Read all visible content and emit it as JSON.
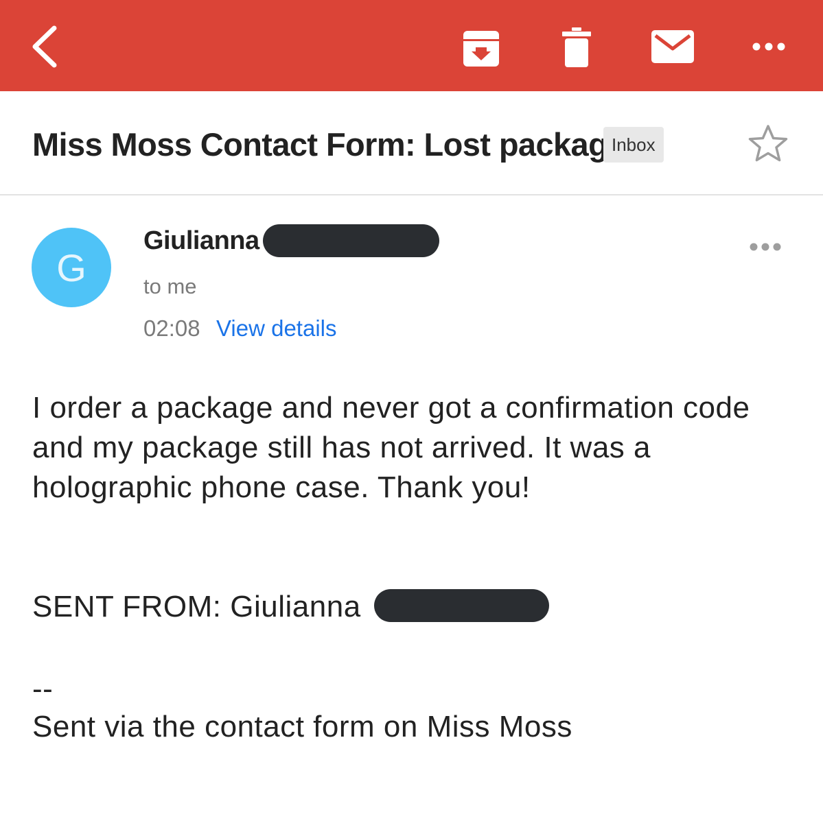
{
  "toolbar": {
    "color": "#db4437",
    "icons": {
      "back": "back-arrow-icon",
      "archive": "archive-icon",
      "delete": "trash-icon",
      "mark_unread": "mail-icon",
      "more": "more-horizontal-icon"
    }
  },
  "message": {
    "subject": "Miss Moss Contact Form: Lost package",
    "label": "Inbox",
    "starred": false,
    "sender": {
      "avatar_letter": "G",
      "avatar_color": "#4fc3f7",
      "name": "Giulianna"
    },
    "recipients": "to me",
    "time": "02:08",
    "view_details": "View details",
    "body": {
      "paragraph": "I order a package and never got a confirmation code and my package still has not arrived. It was a holographic phone case. Thank you!",
      "sent_from": "SENT FROM: Giulianna",
      "signature_separator": "--",
      "signature": "Sent via the contact form on Miss Moss"
    }
  }
}
